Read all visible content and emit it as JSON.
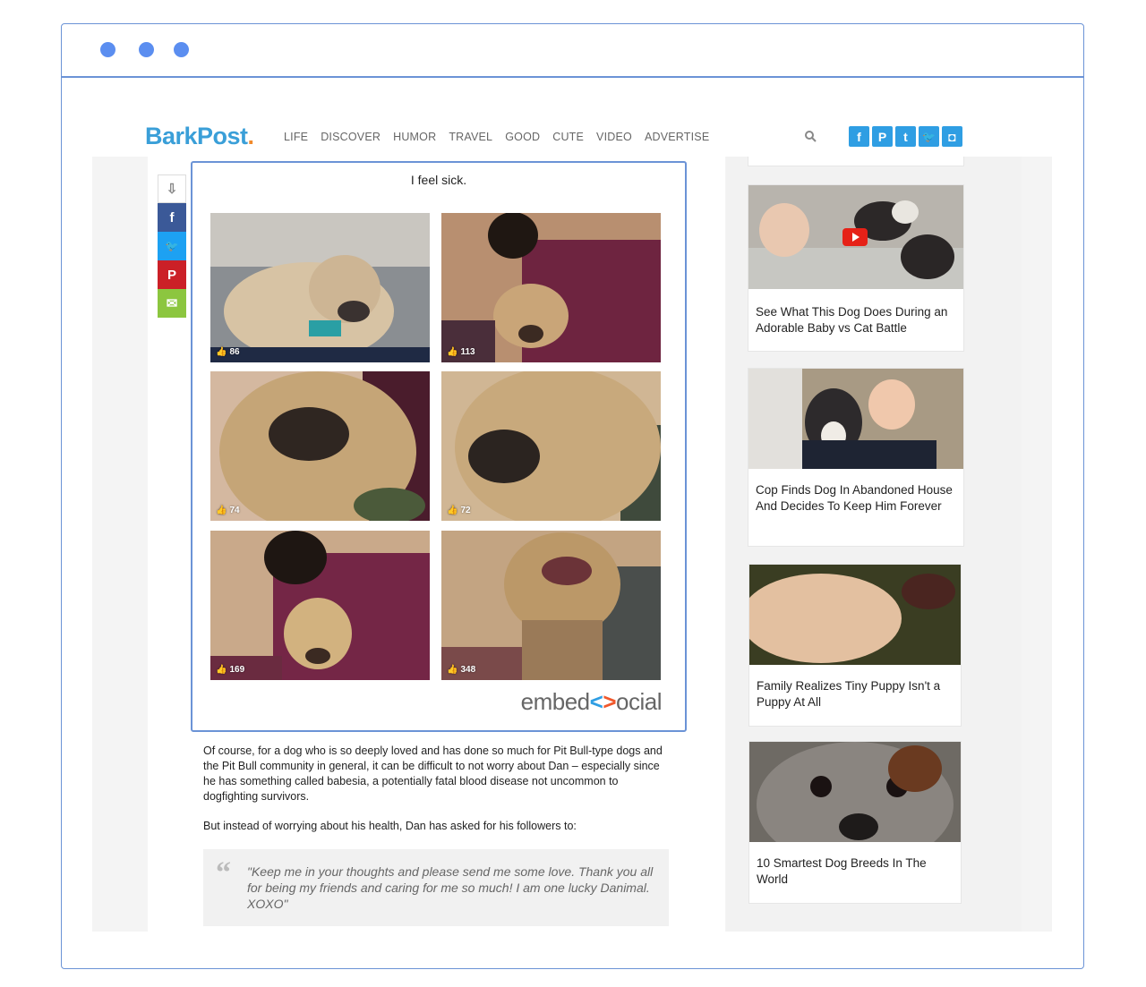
{
  "site": {
    "logo": "BarkPost",
    "logo_dot": ".",
    "nav": [
      "LIFE",
      "DISCOVER",
      "HUMOR",
      "TRAVEL",
      "GOOD",
      "CUTE",
      "VIDEO",
      "ADVERTISE"
    ],
    "social": [
      {
        "icon": "facebook-icon",
        "glyph": "f"
      },
      {
        "icon": "pinterest-icon",
        "glyph": "P"
      },
      {
        "icon": "tumblr-icon",
        "glyph": "t"
      },
      {
        "icon": "twitter-icon",
        "glyph": "🐦"
      },
      {
        "icon": "instagram-icon",
        "glyph": "◘"
      }
    ],
    "accent": "#3a9fd8"
  },
  "share_bar": [
    {
      "icon": "bookmark-icon",
      "color": "#ffffff",
      "glyph": "⇩"
    },
    {
      "icon": "facebook-icon",
      "color": "#3b5998",
      "glyph": "f"
    },
    {
      "icon": "twitter-icon",
      "color": "#1da1f2",
      "glyph": "🐦"
    },
    {
      "icon": "pinterest-icon",
      "color": "#cb2027",
      "glyph": "P"
    },
    {
      "icon": "email-icon",
      "color": "#8cc63f",
      "glyph": "✉"
    }
  ],
  "embed": {
    "title": "I feel sick.",
    "photos": [
      {
        "likes": "86"
      },
      {
        "likes": "113"
      },
      {
        "likes": "74"
      },
      {
        "likes": "72"
      },
      {
        "likes": "169"
      },
      {
        "likes": "348"
      }
    ],
    "brand_a": "embed",
    "brand_lt": "<",
    "brand_gt": ">",
    "brand_b": "ocial"
  },
  "article": {
    "paragraph1": "Of course, for a dog who is so deeply loved and has done so much for Pit Bull-type dogs and the Pit Bull community in general, it can be difficult to not worry about Dan – especially since he has something called babesia, a potentially fatal blood disease not uncommon to dogfighting survivors.",
    "paragraph2": "But instead of worrying about his health, Dan has asked for his followers to:",
    "quote": "\"Keep me in your thoughts and please send me some love. Thank you all for being my friends and caring for me so much! I am one lucky Danimal. XOXO\""
  },
  "sidebar": {
    "cards": [
      {
        "title": "See What This Dog Does During an Adorable Baby vs Cat Battle"
      },
      {
        "title": "Cop Finds Dog In Abandoned House And Decides To Keep Him Forever"
      },
      {
        "title": "Family Realizes Tiny Puppy Isn't a Puppy At All"
      },
      {
        "title": "10 Smartest Dog Breeds In The World"
      }
    ]
  }
}
